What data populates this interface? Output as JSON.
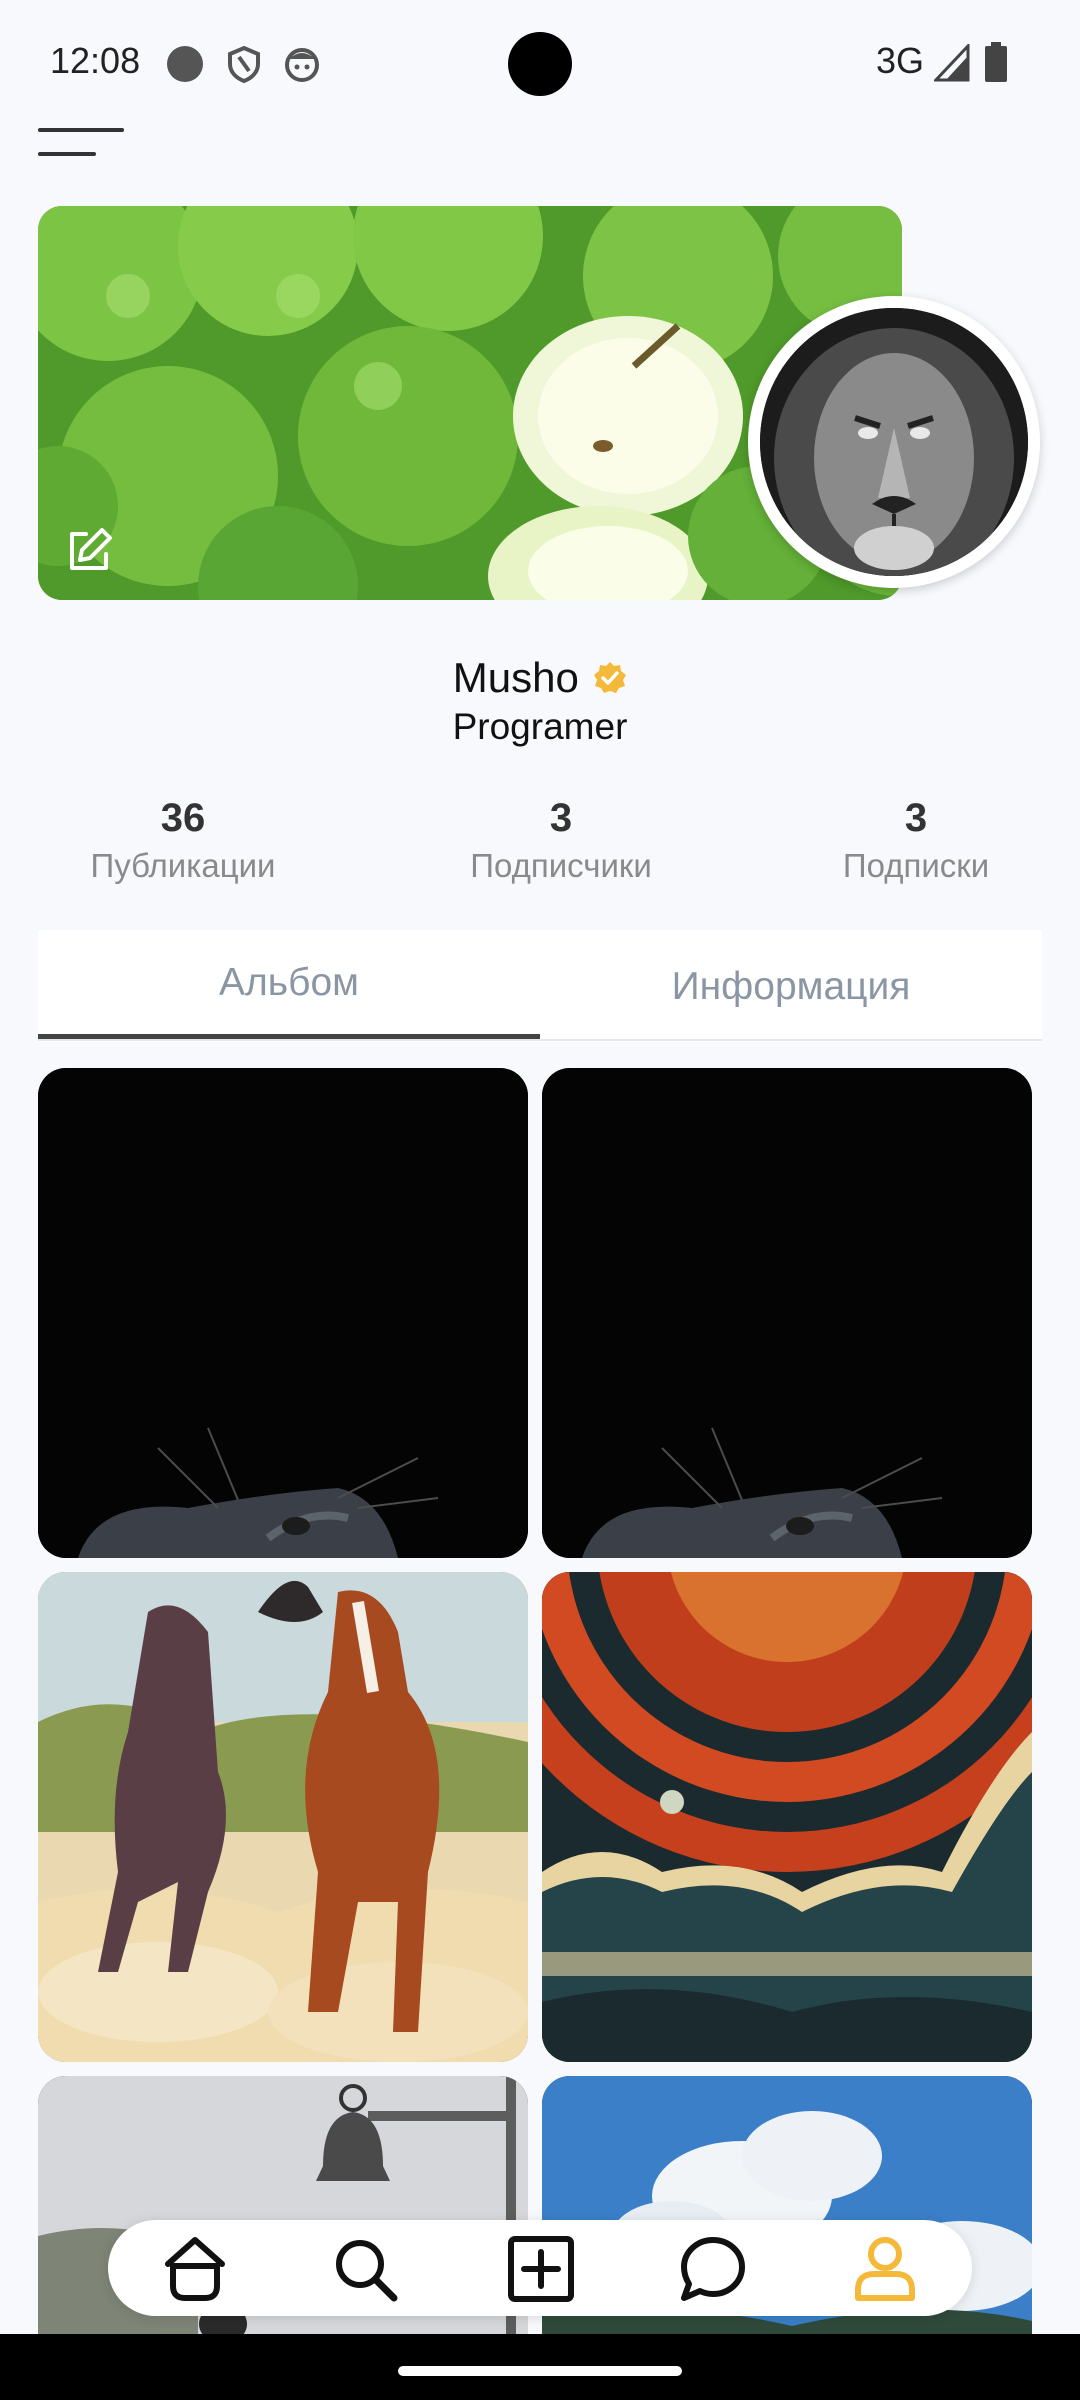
{
  "status_bar": {
    "time": "12:08",
    "network": "3G",
    "icons": [
      "circle-icon",
      "shield-icon",
      "face-icon",
      "signal-icon",
      "battery-icon"
    ]
  },
  "profile": {
    "name": "Musho",
    "role": "Programer",
    "verified_color": "#f5b93a"
  },
  "stats": [
    {
      "value": "36",
      "label": "Публикации"
    },
    {
      "value": "3",
      "label": "Подписчики"
    },
    {
      "value": "3",
      "label": "Подписки"
    }
  ],
  "tabs": [
    {
      "label": "Альбом",
      "active": true
    },
    {
      "label": "Информация",
      "active": false
    }
  ],
  "album": [
    "cat-photo",
    "cat-photo",
    "horses-painting",
    "space-landscape",
    "bell-photo",
    "sky-photo"
  ],
  "bottom_nav": {
    "items": [
      "home-icon",
      "search-icon",
      "add-icon",
      "chat-icon",
      "profile-icon"
    ],
    "active_color": "#f5b93a"
  }
}
